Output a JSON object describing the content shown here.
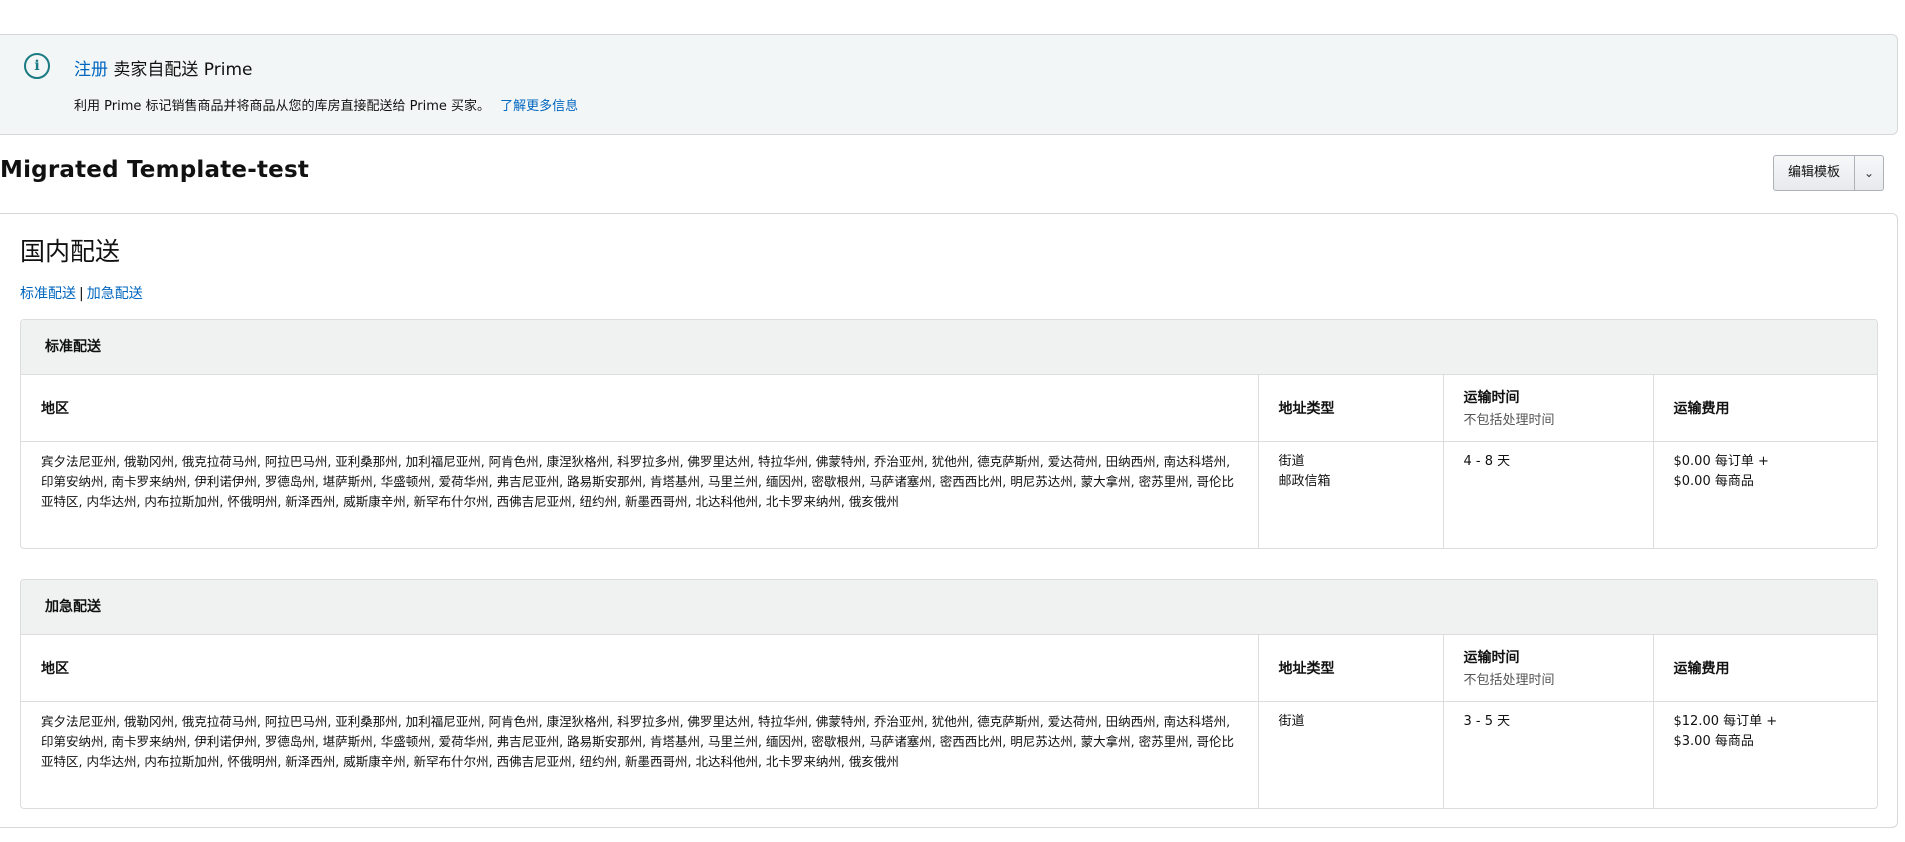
{
  "banner": {
    "link_label": "注册",
    "title_rest": " 卖家自配送 Prime",
    "description": "利用 Prime 标记销售商品并将商品从您的库房直接配送给 Prime 买家。",
    "learn_more": "了解更多信息"
  },
  "template": {
    "title": "Migrated Template-test",
    "edit_label": "编辑模板"
  },
  "domestic": {
    "title": "国内配送",
    "link_standard": "标准配送",
    "separator": "|",
    "link_expedited": "加急配送"
  },
  "table_headers": {
    "region": "地区",
    "address_type": "地址类型",
    "transit_time": "运输时间",
    "transit_note": "不包括处理时间",
    "fee": "运输费用"
  },
  "standard": {
    "heading": "标准配送",
    "regions": "宾夕法尼亚州, 俄勒冈州, 俄克拉荷马州, 阿拉巴马州, 亚利桑那州, 加利福尼亚州, 阿肯色州, 康涅狄格州, 科罗拉多州, 佛罗里达州, 特拉华州, 佛蒙特州, 乔治亚州, 犹他州, 德克萨斯州, 爱达荷州, 田纳西州, 南达科塔州, 印第安纳州, 南卡罗来纳州, 伊利诺伊州, 罗德岛州, 堪萨斯州, 华盛顿州, 爱荷华州, 弗吉尼亚州, 路易斯安那州, 肯塔基州, 马里兰州, 缅因州, 密歇根州, 马萨诸塞州, 密西西比州, 明尼苏达州, 蒙大拿州, 密苏里州, 哥伦比亚特区, 内华达州, 内布拉斯加州, 怀俄明州, 新泽西州, 威斯康辛州, 新罕布什尔州, 西佛吉尼亚州, 纽约州, 新墨西哥州, 北达科他州, 北卡罗来纳州, 俄亥俄州",
    "address_types": [
      "街道",
      "邮政信箱"
    ],
    "transit": "4 - 8 天",
    "fee_lines": [
      "$0.00 每订单 +",
      "$0.00 每商品"
    ]
  },
  "expedited": {
    "heading": "加急配送",
    "regions": "宾夕法尼亚州, 俄勒冈州, 俄克拉荷马州, 阿拉巴马州, 亚利桑那州, 加利福尼亚州, 阿肯色州, 康涅狄格州, 科罗拉多州, 佛罗里达州, 特拉华州, 佛蒙特州, 乔治亚州, 犹他州, 德克萨斯州, 爱达荷州, 田纳西州, 南达科塔州, 印第安纳州, 南卡罗来纳州, 伊利诺伊州, 罗德岛州, 堪萨斯州, 华盛顿州, 爱荷华州, 弗吉尼亚州, 路易斯安那州, 肯塔基州, 马里兰州, 缅因州, 密歇根州, 马萨诸塞州, 密西西比州, 明尼苏达州, 蒙大拿州, 密苏里州, 哥伦比亚特区, 内华达州, 内布拉斯加州, 怀俄明州, 新泽西州, 威斯康辛州, 新罕布什尔州, 西佛吉尼亚州, 纽约州, 新墨西哥州, 北达科他州, 北卡罗来纳州, 俄亥俄州",
    "address_types": [
      "街道"
    ],
    "transit": "3 - 5 天",
    "fee_lines": [
      "$12.00 每订单 +",
      "$3.00 每商品"
    ]
  },
  "icons": {
    "info": "info-icon",
    "dropdown": "chevron-down-icon"
  },
  "colors": {
    "link": "#0066c0",
    "info_accent": "#1a7b82",
    "banner_bg": "#f3f6f6"
  }
}
